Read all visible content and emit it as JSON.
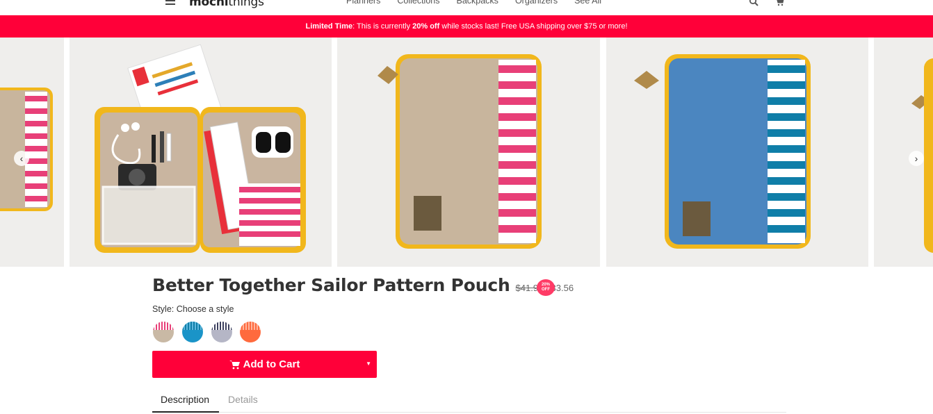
{
  "nav": {
    "logo_left": "mochi",
    "logo_right": "things",
    "links": [
      "Planners",
      "Collections",
      "Backpacks",
      "Organizers",
      "See All"
    ]
  },
  "promo": {
    "lead": "Limited Time",
    "text_a": ": This is currently ",
    "highlight": "20% off",
    "text_b": " while stocks last! Free USA shipping over $75 or more!"
  },
  "carousel": {
    "prev_label": "‹",
    "next_label": "›",
    "slides": [
      "partial-beige-pink-pouch",
      "open-pouch-with-contents",
      "beige-pink-pouch",
      "blue-teal-pouch",
      "partial-next-slide"
    ]
  },
  "product": {
    "title": "Better Together Sailor Pattern Pouch",
    "old_price": "$41.95",
    "new_price": "$33.56",
    "badge_top": "20%",
    "badge_bottom": "OFF",
    "style_label": "Style: Choose a style",
    "swatches": [
      {
        "base": "#c9b9a5",
        "stripe": "#e83f78"
      },
      {
        "base": "#1a94c8",
        "stripe": "#0f7ea8"
      },
      {
        "base": "#b5b6c6",
        "stripe": "#3c3f5e"
      },
      {
        "base": "#ff6a3d",
        "stripe": "#ff9a78"
      }
    ],
    "cart_label": "Add to Cart",
    "tabs": [
      "Description",
      "Details"
    ]
  },
  "colors": {
    "accent": "#ff0039",
    "badge": "#ff3b66"
  }
}
